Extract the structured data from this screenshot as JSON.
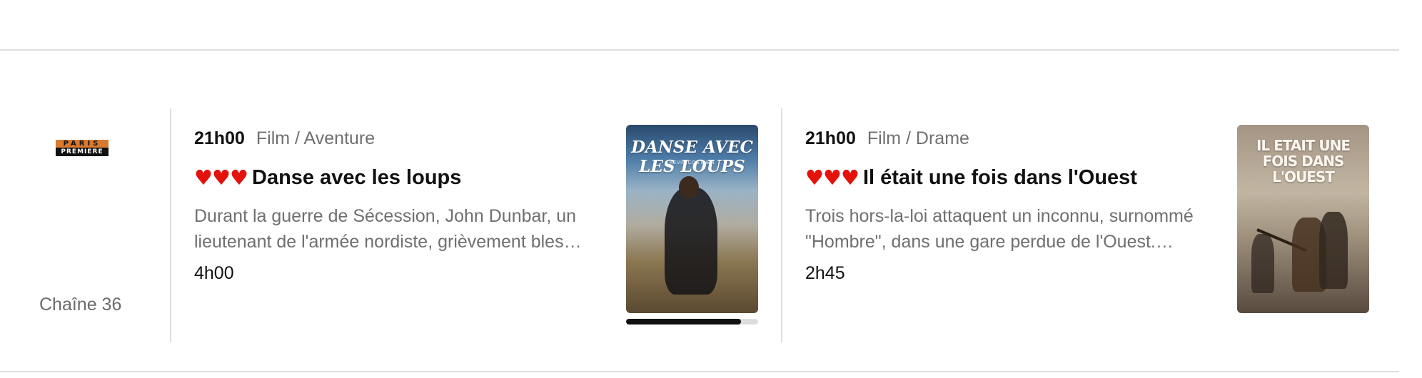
{
  "channel": {
    "logo_top": "PARIS",
    "logo_bottom": "PREMIERE",
    "number_label": "Chaîne 36"
  },
  "programs": [
    {
      "time": "21h00",
      "genre": "Film / Aventure",
      "rating": "♥♥♥",
      "title": "Danse avec les loups",
      "description": "Durant la guerre de Sécession, John Dunbar, un lieutenant de l'armée nordiste, grièvement bles…",
      "duration": "4h00",
      "poster": {
        "title": "DANSE AVEC LES LOUPS",
        "subtitle": "KEVIN COSTNER"
      },
      "progress": 0.87
    },
    {
      "time": "21h00",
      "genre": "Film / Drame",
      "rating": "♥♥♥",
      "title": "Il était une fois dans l'Ouest",
      "description": "Trois hors-la-loi attaquent un inconnu, surnommé \"Hombre\", dans une gare perdue de l'Ouest.…",
      "duration": "2h45",
      "poster": {
        "title": "IL ETAIT UNE FOIS DANS L'OUEST"
      }
    }
  ],
  "colors": {
    "heart": "#e3120b",
    "divider": "#dedede",
    "muted_text": "#6f6f6f",
    "accent_orange": "#d87a2f",
    "progress_fill": "#111111",
    "progress_track": "#dddddd"
  },
  "icons": {
    "rating": "heart-icon",
    "channel_logo": "paris-premiere-logo"
  }
}
